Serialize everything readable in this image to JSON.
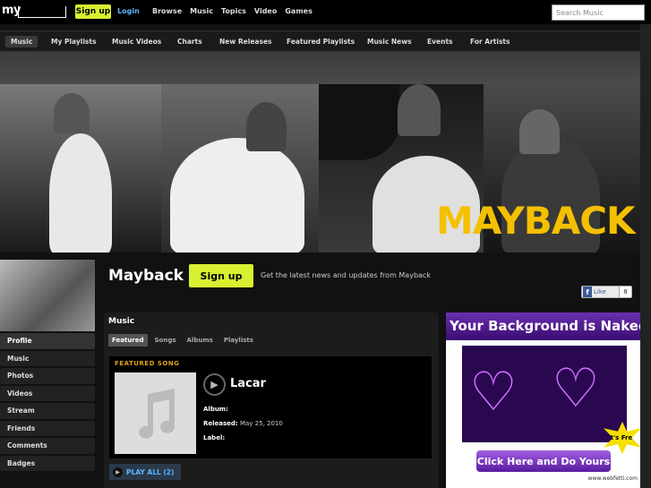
{
  "topbar": {
    "logo": "my",
    "signup": "Sign up",
    "login": "Login",
    "nav": [
      "Browse",
      "Music",
      "Topics",
      "Video",
      "Games"
    ],
    "search_placeholder": "Search Music"
  },
  "subnav": [
    "Music",
    "My Playlists",
    "Music Videos",
    "Charts",
    "New Releases",
    "Featured Playlists",
    "Music News",
    "Events",
    "For Artists"
  ],
  "hero": {
    "title": "MAYBACK"
  },
  "band": {
    "name": "Mayback",
    "signup": "Sign up",
    "tagline": "Get the latest news and updates from Mayback",
    "like_label": "Like",
    "like_count": "8"
  },
  "sidebar": [
    "Profile",
    "Music",
    "Photos",
    "Videos",
    "Stream",
    "Friends",
    "Comments",
    "Badges"
  ],
  "music": {
    "title": "Music",
    "tabs": [
      "Featured",
      "Songs",
      "Albums",
      "Playlists"
    ],
    "featured_label": "FEATURED SONG",
    "song_title": "Lacar",
    "album_label": "Album:",
    "album_value": "",
    "released_label": "Released:",
    "released_value": "May 25, 2010",
    "label_label": "Label:",
    "label_value": "",
    "play_all": "PLAY ALL (2)"
  },
  "ad": {
    "headline": "Your Background is Naked",
    "badge": "It's Free",
    "cta": "Click Here and Do Yours",
    "url": "www.webfetti.com"
  },
  "colors": {
    "accent": "#d8f030",
    "link": "#5fb3ff",
    "hero_title": "#f5c000"
  }
}
